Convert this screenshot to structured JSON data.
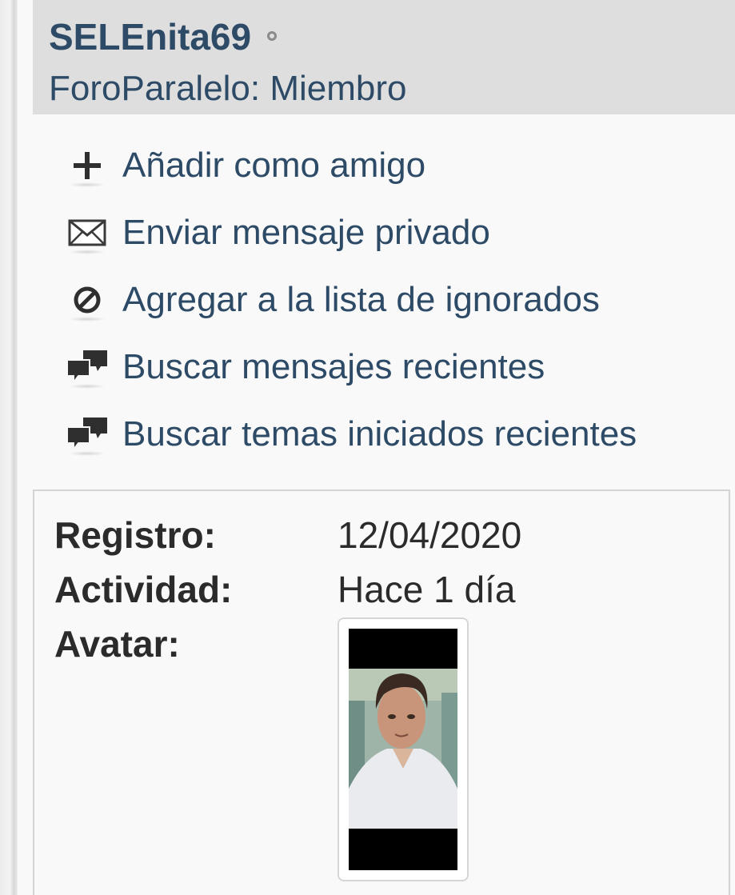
{
  "profile": {
    "username": "SELEnita69",
    "title": "ForoParalelo: Miembro"
  },
  "actions": [
    {
      "label": "Añadir como amigo",
      "icon": "plus-icon"
    },
    {
      "label": "Enviar mensaje privado",
      "icon": "envelope-icon"
    },
    {
      "label": "Agregar a la lista de ignorados",
      "icon": "block-icon"
    },
    {
      "label": "Buscar mensajes recientes",
      "icon": "chat-bubbles-icon"
    },
    {
      "label": "Buscar temas iniciados recientes",
      "icon": "chat-bubbles-icon"
    }
  ],
  "info": {
    "registro_label": "Registro:",
    "registro_value": "12/04/2020",
    "actividad_label": "Actividad:",
    "actividad_value": "Hace 1 día",
    "avatar_label": "Avatar:"
  },
  "colors": {
    "link": "#2d4a66",
    "header_bg": "#dedede",
    "text": "#2b2b2b"
  }
}
